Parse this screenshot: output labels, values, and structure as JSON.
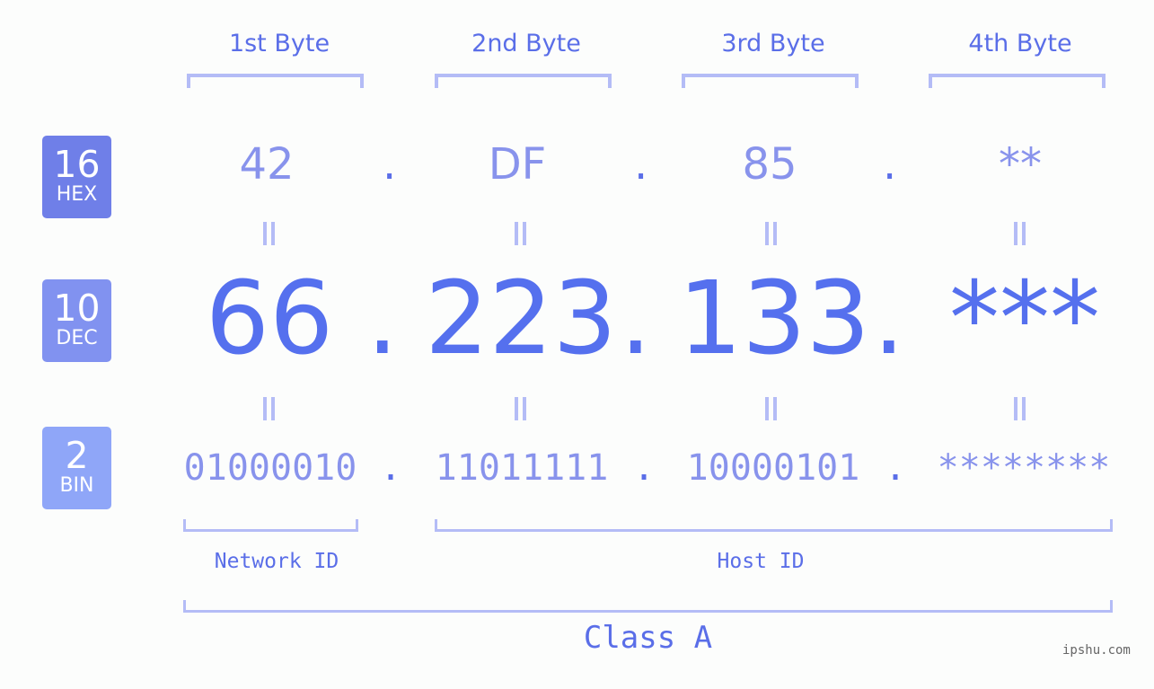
{
  "byte_headers": [
    "1st Byte",
    "2nd Byte",
    "3rd Byte",
    "4th Byte"
  ],
  "badges": [
    {
      "number": "16",
      "label": "HEX",
      "color": "#6f7fe8"
    },
    {
      "number": "10",
      "label": "DEC",
      "color": "#8192f0"
    },
    {
      "number": "2",
      "label": "BIN",
      "color": "#8fa6f8"
    }
  ],
  "hex": [
    "42",
    "DF",
    "85",
    "**"
  ],
  "dec": [
    "66",
    "223",
    "133",
    "***"
  ],
  "bin": [
    "01000010",
    "11011111",
    "10000101",
    "********"
  ],
  "separator": ".",
  "network_id_label": "Network ID",
  "host_id_label": "Host ID",
  "class_label": "Class A",
  "watermark": "ipshu.com",
  "colors": {
    "accent": "#5570ee",
    "light_value": "#8893ec",
    "bracket": "#b4bcf6",
    "background": "#fcfdfc"
  }
}
